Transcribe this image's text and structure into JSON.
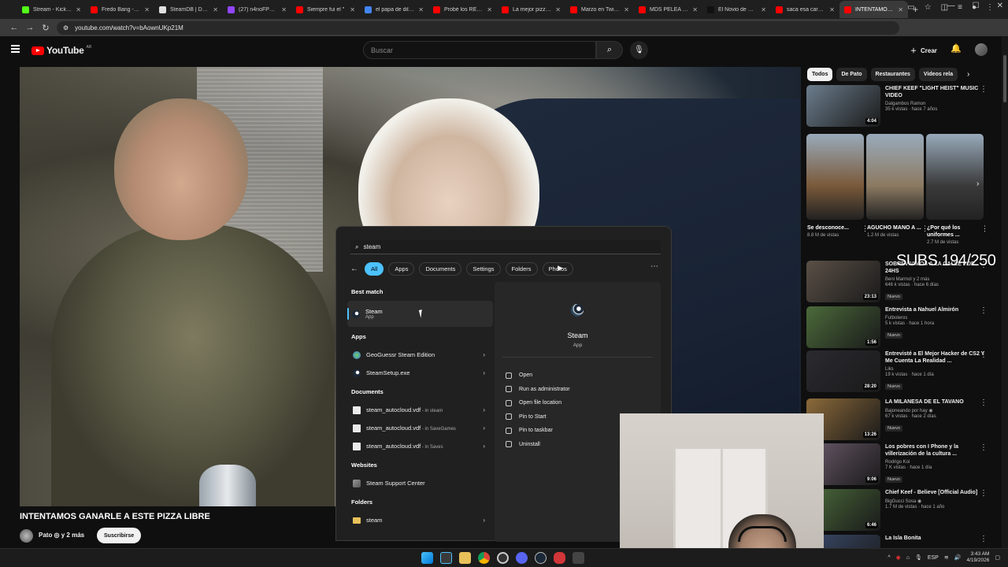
{
  "browser": {
    "tabs": [
      {
        "title": "Stream - Kick De",
        "color": "#53fc18"
      },
      {
        "title": "Fredo Bang - Na",
        "color": "#ff0000"
      },
      {
        "title": "SteamDB | Datab",
        "color": "#e0e0e0"
      },
      {
        "title": "(27) n4noFPS - T",
        "color": "#9146ff"
      },
      {
        "title": "Siempre fui el \"",
        "color": "#ff0000"
      },
      {
        "title": "el papa de dillon",
        "color": "#4285f4"
      },
      {
        "title": "Probé los RESTA",
        "color": "#ff0000"
      },
      {
        "title": "La mejor pizzerí",
        "color": "#ff0000"
      },
      {
        "title": "Marzo en Twitch",
        "color": "#ff0000"
      },
      {
        "title": "MDS PELEA EN",
        "color": "#ff0000"
      },
      {
        "title": "El Novio de Rob",
        "color": "#111111"
      },
      {
        "title": "saca esa cara de",
        "color": "#ff0000"
      },
      {
        "title": "INTENTAMOS G",
        "color": "#ff0000",
        "active": true
      }
    ],
    "url": "youtube.com/watch?v=bAownUKp21M"
  },
  "youtube": {
    "logo_text": "YouTube",
    "country": "AR",
    "search_placeholder": "Buscar",
    "create_label": "Crear",
    "video_title": "INTENTAMOS GANARLE A ESTE PIZZA LIBRE",
    "channel": "Pato ◎ y 2 más",
    "subscribe_label": "Suscribirse",
    "chips": [
      {
        "label": "Todos",
        "active": true
      },
      {
        "label": "De Pato"
      },
      {
        "label": "Restaurantes"
      },
      {
        "label": "Videos rela"
      }
    ],
    "recommendations_top": [
      {
        "title": "CHIEF KEEF \"LIGHT HEIST\" MUSIC VIDEO",
        "channel": "Dalgambos Ramon",
        "views": "35 k vistas · hace 7 años",
        "duration": "4:04",
        "color": "#6b7d8c"
      }
    ],
    "shorts": [
      {
        "title": "Se desconoce...",
        "views": "8.8 M de vistas",
        "color": "#7a5a3a"
      },
      {
        "title": "AGUCHO MANO A ...",
        "views": "1.2 M de vistas",
        "color": "#8c7a62"
      },
      {
        "title": "¿Por qué los uniformes ...",
        "views": "2.7 M de vistas",
        "color": "#3a3a3a"
      }
    ],
    "recommendations": [
      {
        "title": "SOBREVIVIMOS A LA CALLE POR 24HS",
        "channel": "Beni Marmol y 2 más",
        "views": "646 k vistas · hace 6 días",
        "duration": "23:13",
        "badge": "Nuevo",
        "color": "#5a5046"
      },
      {
        "title": "Entrevista a Nahuel Almirón",
        "channel": "Futboleros",
        "views": "5 k vistas · hace 1 hora",
        "duration": "1:56",
        "badge": "Nuevo",
        "color": "#4b6a3a"
      },
      {
        "title": "Entrevisté a El Mejor Hacker de CS2 Y Me Cuenta La Realidad ...",
        "channel": "Liks",
        "views": "19 k vistas · hace 1 día",
        "duration": "28:20",
        "badge": "Nuevo",
        "color": "#2a2a30"
      },
      {
        "title": "LA MILANESA DE EL TAVANO",
        "channel": "Bajoneando por hay ◉",
        "views": "67 k vistas · hace 2 días",
        "duration": "13:26",
        "badge": "Nuevo",
        "color": "#8c6a3a"
      },
      {
        "title": "Los pobres con I Phone y la villerización de la cultura ...",
        "channel": "Rodrigo Koi",
        "views": "7 K vistas · hace 1 día",
        "duration": "9:06",
        "badge": "Nuevo",
        "color": "#6a5a6a"
      },
      {
        "title": "Chief Keef - Believe [Official Audio]",
        "channel": "BigGucci Sosa ◉",
        "views": "1.7 M de vistas · hace 1 año",
        "duration": "6:46",
        "badge": "",
        "color": "#4a6a3a"
      },
      {
        "title": "La Isla Bonita",
        "channel": "",
        "views": "",
        "duration": "",
        "badge": "",
        "color": "#3a4a6a"
      }
    ],
    "stream_overlay": "SUBS 194/250"
  },
  "startmenu": {
    "query": "steam",
    "filters": [
      {
        "label": "All",
        "active": true
      },
      {
        "label": "Apps"
      },
      {
        "label": "Documents"
      },
      {
        "label": "Settings"
      },
      {
        "label": "Folders"
      },
      {
        "label": "Photos"
      }
    ],
    "best_match_header": "Best match",
    "best_match": {
      "name": "Steam",
      "type": "App"
    },
    "apps_header": "Apps",
    "apps": [
      {
        "name": "GeoGuessr Steam Edition",
        "icon": "geo"
      },
      {
        "name": "SteamSetup.exe",
        "icon": "steam"
      }
    ],
    "documents_header": "Documents",
    "documents": [
      {
        "name": "steam_autocloud.vdf",
        "location": " - in steam"
      },
      {
        "name": "steam_autocloud.vdf",
        "location": " - in SaveGames"
      },
      {
        "name": "steam_autocloud.vdf",
        "location": " - in Saves"
      }
    ],
    "websites_header": "Websites",
    "websites": [
      {
        "name": "Steam Support Center"
      }
    ],
    "folders_header": "Folders",
    "folders": [
      {
        "name": "steam"
      }
    ],
    "detail": {
      "name": "Steam",
      "type": "App",
      "actions": [
        "Open",
        "Run as administrator",
        "Open file location",
        "Pin to Start",
        "Pin to taskbar",
        "Uninstall"
      ]
    }
  },
  "taskbar": {
    "lang": "ESP",
    "time": "3:43 AM",
    "date": "4/19/2026"
  }
}
